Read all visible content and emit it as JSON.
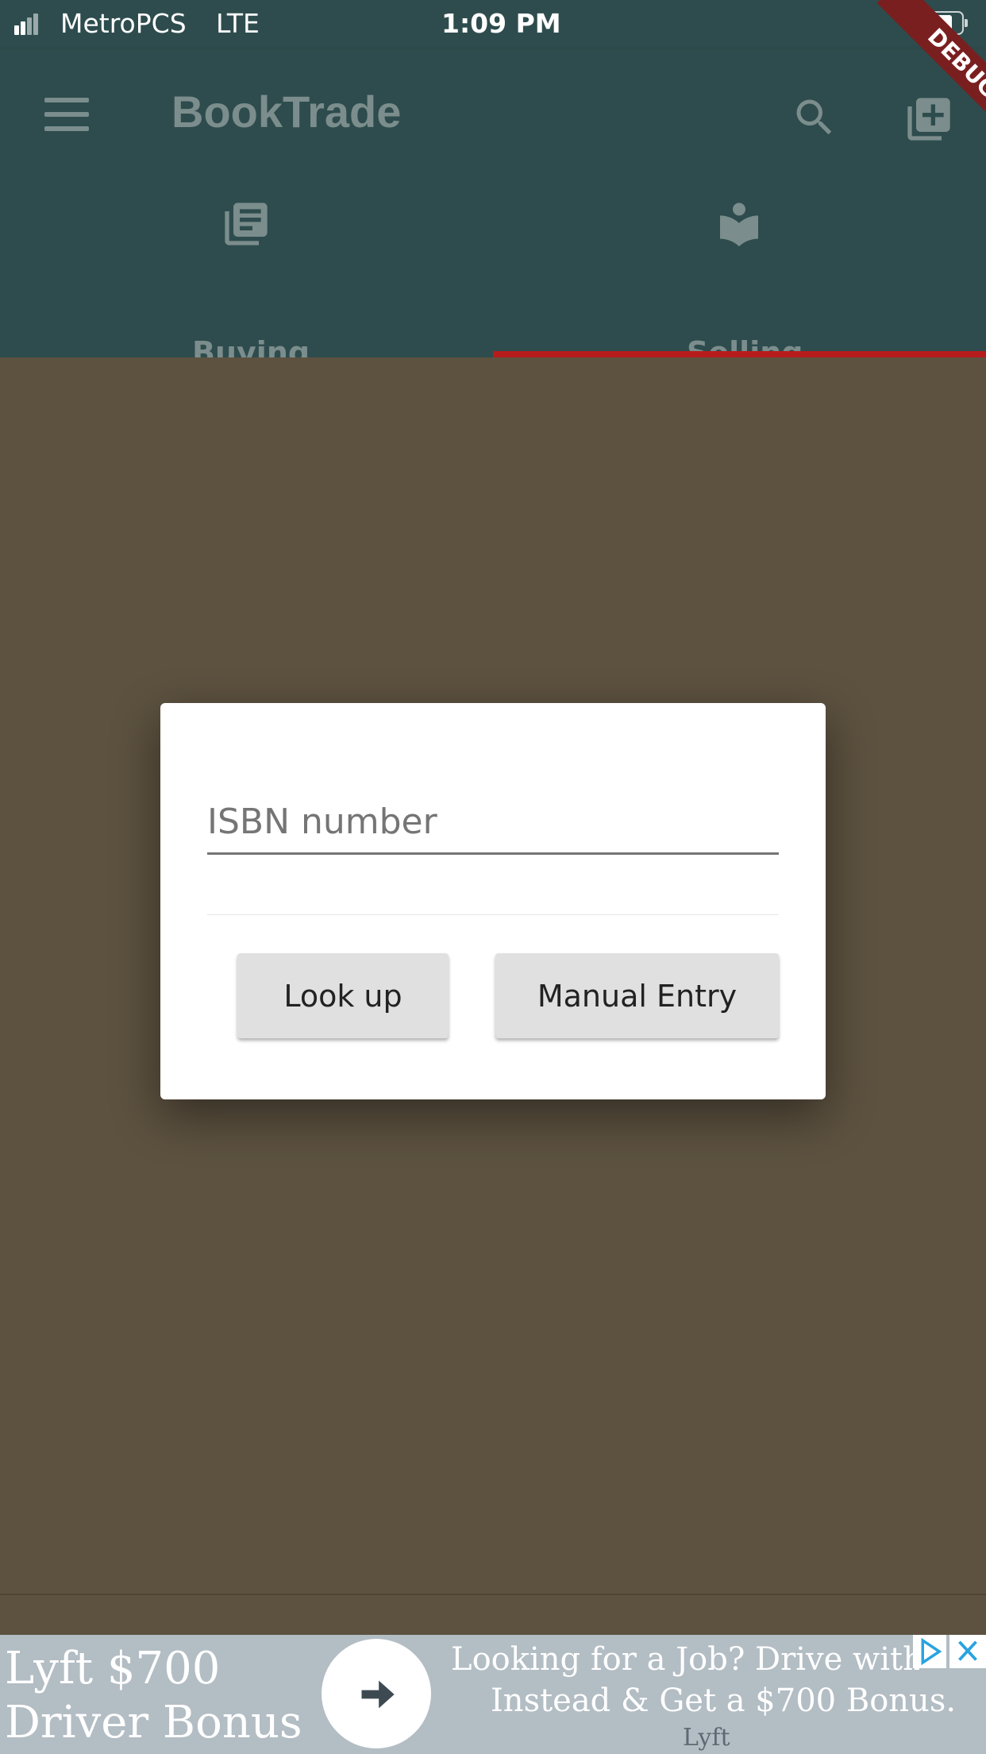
{
  "status_bar": {
    "carrier": "MetroPCS",
    "network": "LTE",
    "time": "1:09 PM",
    "debug_label": "DEBUG"
  },
  "app_bar": {
    "title": "BookTrade",
    "tabs": [
      {
        "label": "Buying",
        "icon": "library-books-icon",
        "selected": false
      },
      {
        "label": "Selling",
        "icon": "local-library-icon",
        "selected": true
      }
    ],
    "accent_color": "#b71c1c"
  },
  "dialog": {
    "isbn_placeholder": "ISBN number",
    "lookup_label": "Look up",
    "manual_label": "Manual Entry"
  },
  "ad": {
    "left_text_1": "Lyft $700",
    "left_text_2": "Driver Bonus",
    "right_text_1": "Looking for a Job? Drive with Ly",
    "right_text_2": "Instead & Get a $700 Bonus.",
    "advertiser": "Lyft"
  },
  "colors": {
    "app_bar": "#2e4c4d",
    "scrim": "#5d5240",
    "ad_bg": "#b3bdc4"
  }
}
